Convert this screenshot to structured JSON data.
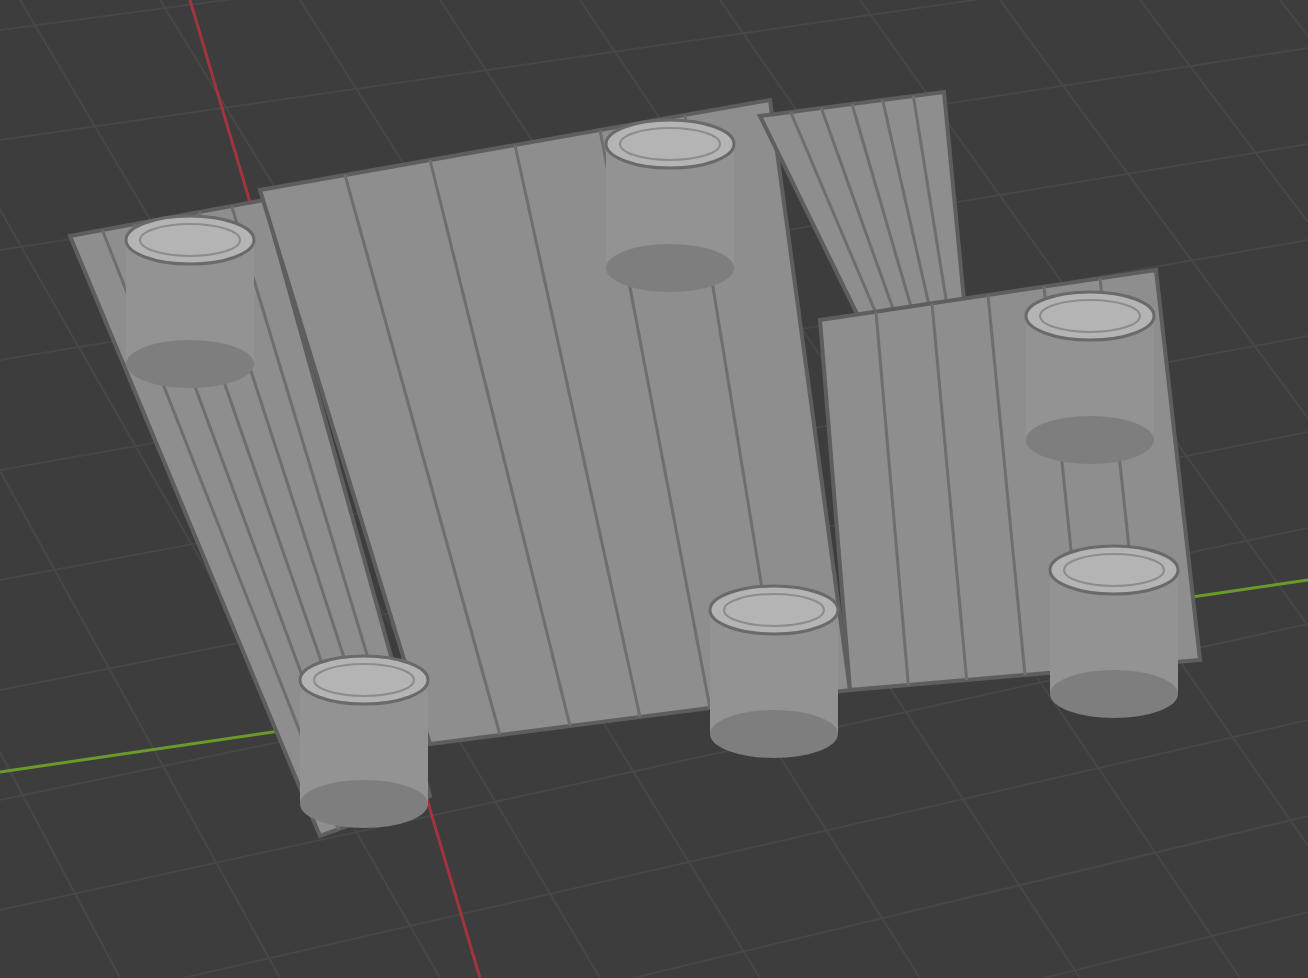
{
  "viewport": {
    "axes": [
      {
        "kind": "x",
        "color": "#a2343f"
      },
      {
        "kind": "y",
        "color": "#6b9a2c"
      }
    ],
    "objects": [
      {
        "kind": "panel"
      },
      {
        "kind": "panel"
      },
      {
        "kind": "panel"
      },
      {
        "kind": "panel"
      },
      {
        "kind": "barrel"
      },
      {
        "kind": "barrel"
      },
      {
        "kind": "barrel"
      },
      {
        "kind": "barrel"
      },
      {
        "kind": "barrel"
      },
      {
        "kind": "barrel"
      }
    ]
  }
}
